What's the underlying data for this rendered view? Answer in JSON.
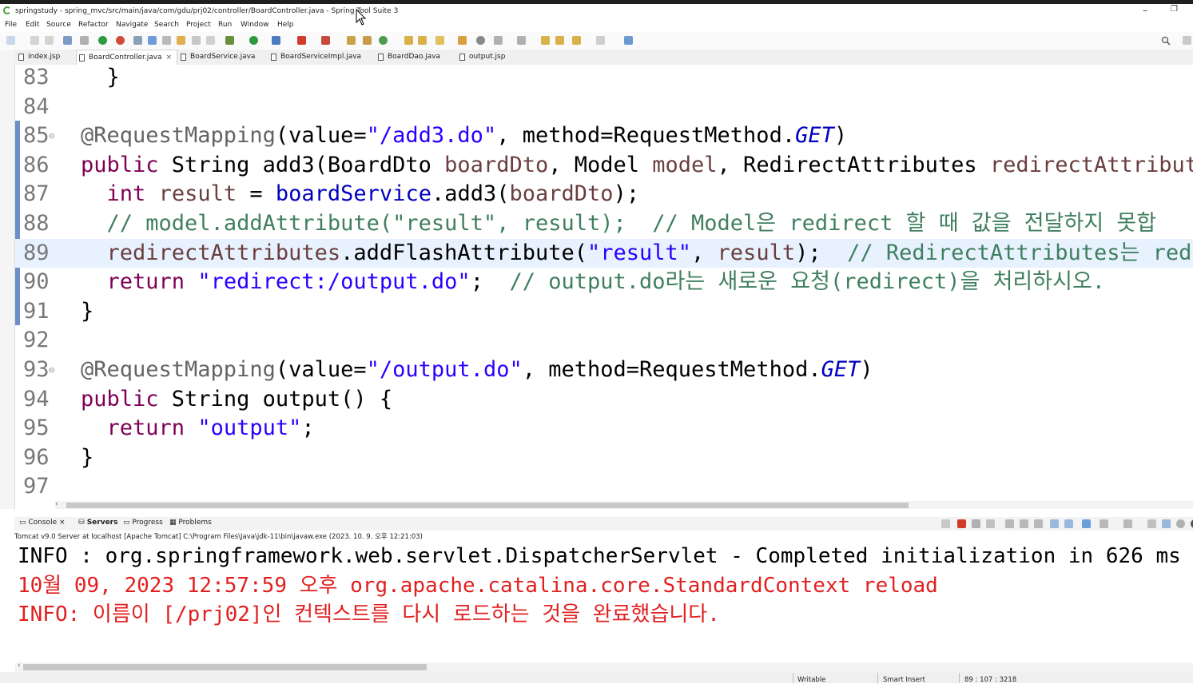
{
  "window": {
    "title": "springstudy - spring_mvc/src/main/java/com/gdu/prj02/controller/BoardController.java - Spring Tool Suite 3",
    "minimize": "–",
    "restore": "❐"
  },
  "menu": [
    "File",
    "Edit",
    "Source",
    "Refactor",
    "Navigate",
    "Search",
    "Project",
    "Run",
    "Window",
    "Help"
  ],
  "tabs": [
    {
      "label": "index.jsp",
      "active": false
    },
    {
      "label": "BoardController.java",
      "active": true,
      "close": "×"
    },
    {
      "label": "BoardService.java",
      "active": false
    },
    {
      "label": "BoardServiceImpl.java",
      "active": false
    },
    {
      "label": "BoardDao.java",
      "active": false
    },
    {
      "label": "output.jsp",
      "active": false
    }
  ],
  "editor": {
    "lines": [
      {
        "num": "83",
        "fold": "",
        "tokens": [
          [
            "",
            "  }"
          ]
        ]
      },
      {
        "num": "84",
        "fold": "",
        "tokens": []
      },
      {
        "num": "85",
        "fold": "⊖",
        "tokens": [
          [
            "ann",
            "@RequestMapping"
          ],
          [
            "",
            "(value="
          ],
          [
            "str",
            "\"/add3.do\""
          ],
          [
            "",
            ", method=RequestMethod."
          ],
          [
            "stc",
            "GET"
          ],
          [
            "",
            ")"
          ]
        ]
      },
      {
        "num": "86",
        "fold": "",
        "tokens": [
          [
            "kw",
            "public"
          ],
          [
            "",
            " String add3(BoardDto "
          ],
          [
            "var",
            "boardDto"
          ],
          [
            "",
            ", Model "
          ],
          [
            "var",
            "model"
          ],
          [
            "",
            ", RedirectAttributes "
          ],
          [
            "var",
            "redirectAttributes"
          ]
        ]
      },
      {
        "num": "87",
        "fold": "",
        "tokens": [
          [
            "",
            "  "
          ],
          [
            "kw",
            "int"
          ],
          [
            "",
            " "
          ],
          [
            "var",
            "result"
          ],
          [
            "",
            " = "
          ],
          [
            "fld",
            "boardService"
          ],
          [
            "",
            ".add3("
          ],
          [
            "var",
            "boardDto"
          ],
          [
            "",
            ");"
          ]
        ]
      },
      {
        "num": "88",
        "fold": "",
        "tokens": [
          [
            "",
            "  "
          ],
          [
            "cm",
            "// model.addAttribute(\"result\", result);  // Model은 redirect 할 때 값을 전달하지 못합"
          ]
        ]
      },
      {
        "num": "89",
        "fold": "",
        "highlight": true,
        "tokens": [
          [
            "",
            "  "
          ],
          [
            "var",
            "redirectAttributes"
          ],
          [
            "",
            ".addFlashAttribute("
          ],
          [
            "str",
            "\"result\""
          ],
          [
            "",
            ", "
          ],
          [
            "var",
            "result"
          ],
          [
            "",
            ");  "
          ],
          [
            "cm",
            "// RedirectAttributes는 redir"
          ]
        ]
      },
      {
        "num": "90",
        "fold": "",
        "tokens": [
          [
            "",
            "  "
          ],
          [
            "kw",
            "return"
          ],
          [
            "",
            " "
          ],
          [
            "str",
            "\"redirect:/output.do\""
          ],
          [
            "",
            ";  "
          ],
          [
            "cm",
            "// output.do라는 새로운 요청(redirect)을 처리하시오."
          ]
        ]
      },
      {
        "num": "91",
        "fold": "",
        "tokens": [
          [
            "",
            "}"
          ]
        ]
      },
      {
        "num": "92",
        "fold": "",
        "tokens": []
      },
      {
        "num": "93",
        "fold": "⊖",
        "tokens": [
          [
            "ann",
            "@RequestMapping"
          ],
          [
            "",
            "(value="
          ],
          [
            "str",
            "\"/output.do\""
          ],
          [
            "",
            ", method=RequestMethod."
          ],
          [
            "stc",
            "GET"
          ],
          [
            "",
            ")"
          ]
        ]
      },
      {
        "num": "94",
        "fold": "",
        "tokens": [
          [
            "kw",
            "public"
          ],
          [
            "",
            " String output() {"
          ]
        ]
      },
      {
        "num": "95",
        "fold": "",
        "tokens": [
          [
            "",
            "  "
          ],
          [
            "kw",
            "return"
          ],
          [
            "",
            " "
          ],
          [
            "str",
            "\"output\""
          ],
          [
            "",
            ";"
          ]
        ]
      },
      {
        "num": "96",
        "fold": "",
        "tokens": [
          [
            "",
            "}"
          ]
        ]
      },
      {
        "num": "97",
        "fold": "",
        "tokens": []
      }
    ]
  },
  "console_tabs": [
    {
      "label": "Console",
      "close": "×"
    },
    {
      "label": "Servers",
      "bold": true
    },
    {
      "label": "Progress"
    },
    {
      "label": "Problems"
    }
  ],
  "console": {
    "server_info": "Tomcat v9.0 Server at localhost [Apache Tomcat] C:\\Program Files\\Java\\jdk-11\\bin\\javaw.exe  (2023. 10. 9. 오후 12:21:03)",
    "lines": [
      {
        "color": "black",
        "text": "INFO : org.springframework.web.servlet.DispatcherServlet - Completed initialization in 626 ms"
      },
      {
        "color": "red",
        "text": "10월 09, 2023 12:57:59 오후 org.apache.catalina.core.StandardContext reload"
      },
      {
        "color": "red",
        "text": "INFO: 이름이 [/prj02]인 컨텍스트를 다시 로드하는 것을 완료했습니다."
      }
    ]
  },
  "status": {
    "writable": "Writable",
    "insert_mode": "Smart Insert",
    "position": "89 : 107 : 3218"
  },
  "colors": {
    "keyword": "#7f0055",
    "string": "#2a00ff",
    "comment": "#3f7f5f",
    "field": "#0000c0",
    "variable": "#6a3e3e",
    "annotation": "#646464",
    "console_error": "#e12020"
  }
}
